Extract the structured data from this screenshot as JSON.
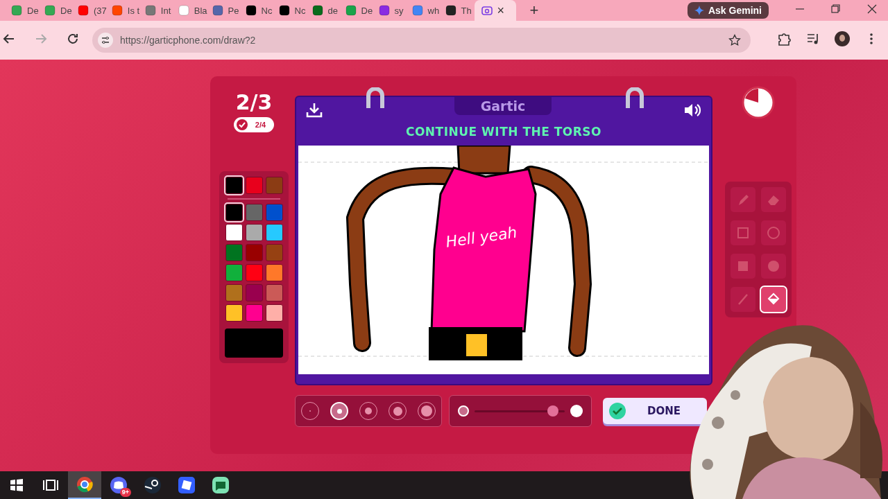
{
  "browser": {
    "tabs": [
      {
        "label": "De",
        "selected": false
      },
      {
        "label": "De",
        "selected": false
      },
      {
        "label": "(37",
        "selected": false
      },
      {
        "label": "Is t",
        "selected": false
      },
      {
        "label": "Int",
        "selected": false
      },
      {
        "label": "Bla",
        "selected": false
      },
      {
        "label": "Pe",
        "selected": false
      },
      {
        "label": "Nc",
        "selected": false
      },
      {
        "label": "Nc",
        "selected": false
      },
      {
        "label": "de",
        "selected": false
      },
      {
        "label": "De",
        "selected": false
      },
      {
        "label": "sy",
        "selected": false
      },
      {
        "label": "wh",
        "selected": false
      },
      {
        "label": "Th",
        "selected": false
      },
      {
        "close": "×",
        "selected": true
      }
    ],
    "new_tab": "+",
    "gemini": "Ask Gemini",
    "url": "https://garticphone.com/draw?2"
  },
  "game": {
    "round": "2/3",
    "done_count": "2/4",
    "logo": "Gartic",
    "prompt": "CONTINUE WITH THE TORSO",
    "palette": {
      "recent": [
        {
          "color": "#000000",
          "selected": true
        },
        {
          "color": "#e8001c",
          "selected": false
        },
        {
          "color": "#8b3c14",
          "selected": false
        }
      ],
      "colors": [
        {
          "color": "#000000",
          "selected": true
        },
        {
          "color": "#666666",
          "selected": false
        },
        {
          "color": "#0050cd",
          "selected": false
        },
        {
          "color": "#ffffff",
          "selected": false
        },
        {
          "color": "#aaaaaa",
          "selected": false
        },
        {
          "color": "#26c9ff",
          "selected": false
        },
        {
          "color": "#017420",
          "selected": false
        },
        {
          "color": "#990000",
          "selected": false
        },
        {
          "color": "#964112",
          "selected": false
        },
        {
          "color": "#11b03c",
          "selected": false
        },
        {
          "color": "#ff0013",
          "selected": false
        },
        {
          "color": "#ff7829",
          "selected": false
        },
        {
          "color": "#b0701c",
          "selected": false
        },
        {
          "color": "#99004e",
          "selected": false
        },
        {
          "color": "#cb5a57",
          "selected": false
        },
        {
          "color": "#ffc126",
          "selected": false
        },
        {
          "color": "#ff008f",
          "selected": false
        },
        {
          "color": "#feafa8",
          "selected": false
        }
      ],
      "current": {
        "color": "#000000"
      }
    },
    "canvas": {
      "shirt_text": "Hell yeah"
    },
    "tools": [
      {
        "kind": "pencil",
        "selected": false
      },
      {
        "kind": "eraser",
        "selected": false
      },
      {
        "kind": "rect",
        "selected": false
      },
      {
        "kind": "ellipse",
        "selected": false
      },
      {
        "kind": "filled-rect",
        "selected": false
      },
      {
        "kind": "filled-ellipse",
        "selected": false
      },
      {
        "kind": "line",
        "selected": false
      },
      {
        "kind": "bucket",
        "selected": true
      }
    ],
    "brush_sizes": [
      {
        "selected": false
      },
      {
        "selected": true
      },
      {
        "selected": false
      },
      {
        "selected": false
      },
      {
        "selected": false
      }
    ],
    "opacity": {
      "level": 0.93
    },
    "done_button": "DONE"
  },
  "taskbar": {
    "apps": [
      {
        "kind": "start",
        "selected": false
      },
      {
        "kind": "task-view",
        "selected": false
      },
      {
        "kind": "chrome",
        "selected": true
      },
      {
        "kind": "discord",
        "selected": false,
        "badge": "9+"
      },
      {
        "kind": "steam",
        "selected": false
      },
      {
        "kind": "roblox",
        "selected": false
      },
      {
        "kind": "chat",
        "selected": false
      }
    ]
  }
}
